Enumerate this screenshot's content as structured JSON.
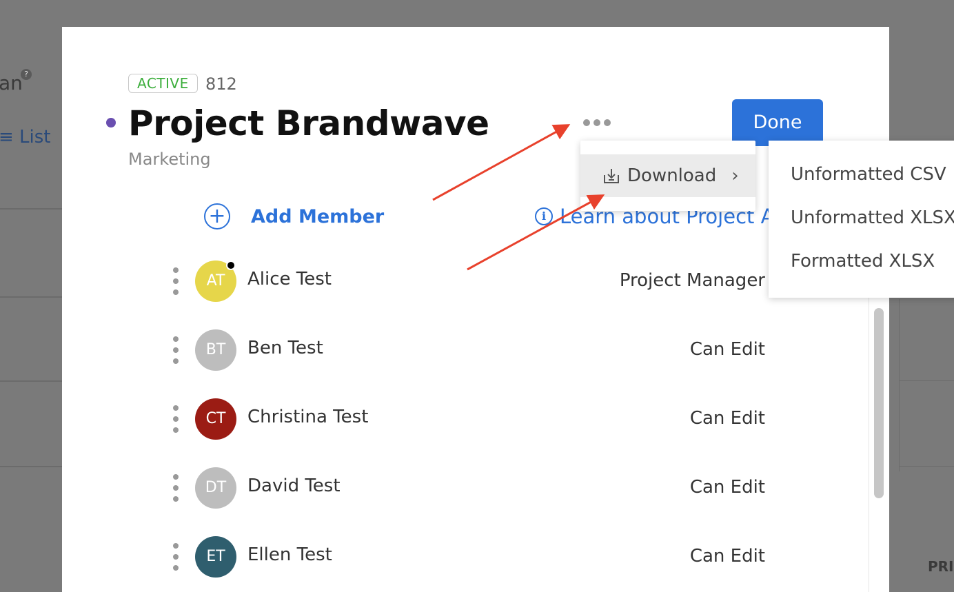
{
  "background": {
    "partial_text": "an",
    "help_glyph": "?",
    "list_label": "≡ List",
    "corner_text": "PRI"
  },
  "modal": {
    "status": "ACTIVE",
    "project_id": "812",
    "title": "Project Brandwave",
    "subtitle": "Marketing",
    "done_label": "Done",
    "add_member_label": "Add Member",
    "learn_label": "Learn about Project A",
    "members": [
      {
        "initials": "AT",
        "name": "Alice Test",
        "role": "Project Manager",
        "color": "#e6d64a",
        "online": true
      },
      {
        "initials": "BT",
        "name": "Ben Test",
        "role": "Can Edit",
        "color": "#bdbdbd",
        "online": false
      },
      {
        "initials": "CT",
        "name": "Christina Test",
        "role": "Can Edit",
        "color": "#9b1c14",
        "online": false
      },
      {
        "initials": "DT",
        "name": "David Test",
        "role": "Can Edit",
        "color": "#bdbdbd",
        "online": false
      },
      {
        "initials": "ET",
        "name": "Ellen Test",
        "role": "Can Edit",
        "color": "#2f5e6e",
        "online": false
      }
    ]
  },
  "menu": {
    "download_label": "Download",
    "chevron": "›",
    "submenu": [
      "Unformatted CSV",
      "Unformatted XLSX",
      "Formatted XLSX"
    ]
  },
  "colors": {
    "accent": "#2c72d9",
    "active_green": "#3cae3c",
    "project_dot": "#6a4fb0",
    "annotation": "#e8412c"
  }
}
